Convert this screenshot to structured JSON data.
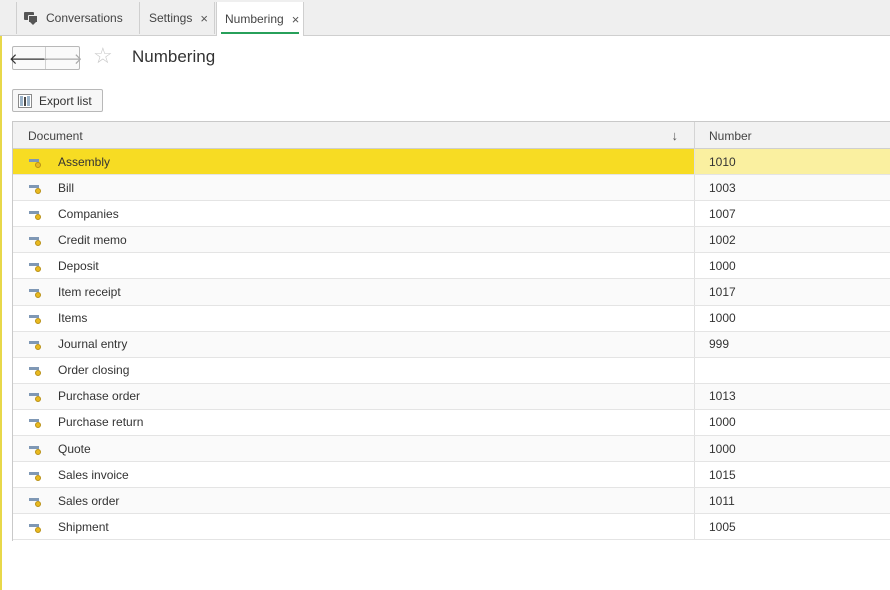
{
  "tabs": [
    {
      "label": "Conversations",
      "icon": "chat-icon",
      "closable": false,
      "active": false
    },
    {
      "label": "Settings",
      "closable": true,
      "active": false
    },
    {
      "label": "Numbering",
      "closable": true,
      "active": true
    }
  ],
  "close_glyph": "×",
  "page": {
    "title": "Numbering",
    "back_glyph": "🡐",
    "forward_glyph": "🡒",
    "star_glyph": "☆"
  },
  "toolbar": {
    "export_label": "Export list"
  },
  "table": {
    "columns": [
      "Document",
      "Number"
    ],
    "sort_indicator": "↓",
    "selected_row": 0,
    "rows": [
      {
        "document": "Assembly",
        "number": "1010"
      },
      {
        "document": "Bill",
        "number": "1003"
      },
      {
        "document": "Companies",
        "number": "1007"
      },
      {
        "document": "Credit memo",
        "number": "1002"
      },
      {
        "document": "Deposit",
        "number": "1000"
      },
      {
        "document": "Item receipt",
        "number": "1017"
      },
      {
        "document": "Items",
        "number": "1000"
      },
      {
        "document": "Journal entry",
        "number": "999"
      },
      {
        "document": "Order closing",
        "number": ""
      },
      {
        "document": "Purchase order",
        "number": "1013"
      },
      {
        "document": "Purchase return",
        "number": "1000"
      },
      {
        "document": "Quote",
        "number": "1000"
      },
      {
        "document": "Sales invoice",
        "number": "1015"
      },
      {
        "document": "Sales order",
        "number": "1011"
      },
      {
        "document": "Shipment",
        "number": "1005"
      }
    ]
  },
  "colors": {
    "selected_row": "#f7dc23",
    "active_tab_underline": "#27a05a",
    "left_strip": "#e8d84a"
  }
}
